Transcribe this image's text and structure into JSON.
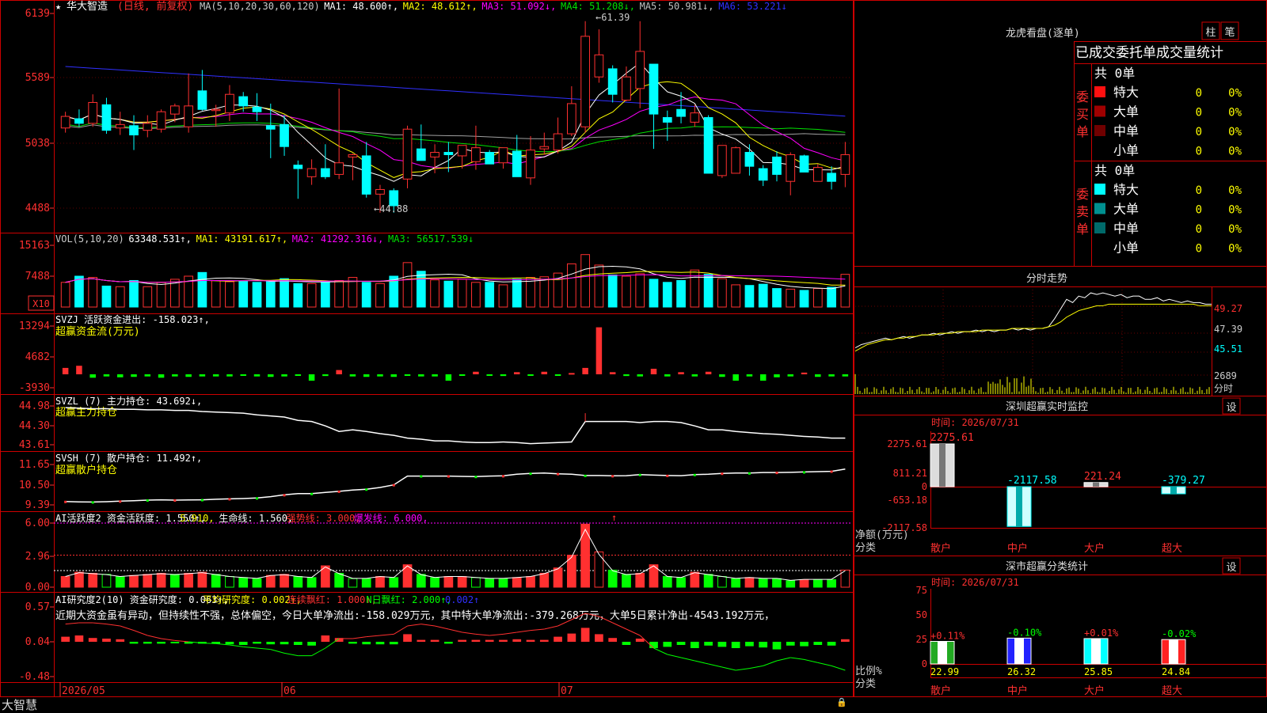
{
  "app": {
    "brand": "大智慧",
    "stock_name": "华大智造",
    "adj_note": "(日线, 前复权)",
    "lock_icon": "lock-icon"
  },
  "colors": {
    "up": "#ff3030",
    "down": "#00ffff",
    "ma1": "#ffffff",
    "ma2": "#ffff00",
    "ma3": "#ff00ff",
    "ma4": "#00e000",
    "ma5": "#a0a0a0",
    "ma6": "#3030ff",
    "grid": "#880000",
    "yellow": "#ffff00",
    "green": "#00ff00"
  },
  "price_panel": {
    "header": [
      {
        "t": "MA(5,10,20,30,60,120)",
        "c": "#ccc"
      },
      {
        "t": "MA1: 48.600↑,",
        "c": "#ffffff"
      },
      {
        "t": "MA2: 48.612↑,",
        "c": "#ffff00"
      },
      {
        "t": "MA3: 51.092↓,",
        "c": "#ff00ff"
      },
      {
        "t": "MA4: 51.208↓,",
        "c": "#00e000"
      },
      {
        "t": "MA5: 50.981↓,",
        "c": "#c0c0c0"
      },
      {
        "t": "MA6: 53.221↓",
        "c": "#3030ff"
      }
    ],
    "y_ticks": [
      "6139",
      "5589",
      "5038",
      "4488"
    ],
    "high_label": "61.39",
    "low_label": "44.88"
  },
  "vol_panel": {
    "header": [
      {
        "t": "VOL(5,10,20)",
        "c": "#ccc"
      },
      {
        "t": "63348.531↑,",
        "c": "#ffffff"
      },
      {
        "t": "MA1: 43191.617↑,",
        "c": "#ffff00"
      },
      {
        "t": "MA2: 41292.316↓,",
        "c": "#ff00ff"
      },
      {
        "t": "MA3: 56517.539↓",
        "c": "#00e000"
      }
    ],
    "y_ticks": [
      "15163",
      "7488"
    ],
    "unit": "X10"
  },
  "svzj_panel": {
    "header": [
      {
        "t": "SVZJ  活跃资金进出: -158.023↑,",
        "c": "#fff"
      }
    ],
    "sub": "超赢资金流(万元)",
    "y_ticks": [
      "13294",
      "4682",
      "-3930"
    ]
  },
  "svzl_panel": {
    "header": [
      {
        "t": "SVZL (7) 主力持仓: 43.692↓,",
        "c": "#fff"
      }
    ],
    "sub": "超赢主力持仓",
    "y_ticks": [
      "44.98",
      "44.30",
      "43.61"
    ]
  },
  "svsh_panel": {
    "header": [
      {
        "t": "SVSH (7) 散户持仓: 11.492↑,",
        "c": "#fff"
      }
    ],
    "sub": "超赢散户持仓",
    "y_ticks": [
      "11.65",
      "10.50",
      "9.39"
    ]
  },
  "ai_panel": {
    "header": [
      {
        "t": "AI活跃度2 资金活跃度: 1.550↑,",
        "c": "#fff"
      },
      {
        "t": "5.910,",
        "c": "#ffff00"
      },
      {
        "t": "生命线: 1.560,",
        "c": "#fff"
      },
      {
        "t": "强势线: 3.000,",
        "c": "#ff3030"
      },
      {
        "t": "爆发线: 6.000,",
        "c": "#ff00ff"
      }
    ],
    "y_ticks": [
      "6.00",
      "2.96",
      "0.00"
    ]
  },
  "ai2_panel": {
    "header": [
      {
        "t": "AI研究度2(10) 资金研究度: 0.063↑,",
        "c": "#fff"
      },
      {
        "t": "平均研究度: 0.002↑,",
        "c": "#ffff00"
      },
      {
        "t": "连续飘红: 1.000↑,",
        "c": "#ff3030"
      },
      {
        "t": "N日飘红: 2.000↑,",
        "c": "#00ff00"
      },
      {
        "t": "0.002↑",
        "c": "#3030ff"
      }
    ],
    "comment": "近期大资金虽有异动，但持续性不强，总体偏空，今日大单净流出:-158.029万元，其中特大单净流出:-379.268万元，大单5日累计净出-4543.192万元，",
    "y_ticks": [
      "0.57",
      "0.04",
      "-0.48"
    ]
  },
  "x_axis": [
    "2026/05",
    "06",
    "07"
  ],
  "candles": [
    [
      52.2,
      53.6,
      51.8,
      53.2
    ],
    [
      53.0,
      53.8,
      52.3,
      52.6
    ],
    [
      52.6,
      55.1,
      52.3,
      54.4
    ],
    [
      54.2,
      54.8,
      51.7,
      52.0
    ],
    [
      52.2,
      53.6,
      51.6,
      52.5
    ],
    [
      52.4,
      53.3,
      50.3,
      51.6
    ],
    [
      52.0,
      53.3,
      51.4,
      52.6
    ],
    [
      52.1,
      53.8,
      51.8,
      53.6
    ],
    [
      53.4,
      54.3,
      52.7,
      54.1
    ],
    [
      52.3,
      56.9,
      51.8,
      54.1
    ],
    [
      55.4,
      57.2,
      53.7,
      53.8
    ],
    [
      53.7,
      54.2,
      52.3,
      53.8
    ],
    [
      53.5,
      55.9,
      52.8,
      55.1
    ],
    [
      54.9,
      55.3,
      53.6,
      54.1
    ],
    [
      54.0,
      55.2,
      52.8,
      53.6
    ],
    [
      52.4,
      54.3,
      49.6,
      52.1
    ],
    [
      52.5,
      53.3,
      49.8,
      50.6
    ],
    [
      49.0,
      49.4,
      46.1,
      48.7
    ],
    [
      48.0,
      49.5,
      47.3,
      48.7
    ],
    [
      48.7,
      50.8,
      47.8,
      48.0
    ],
    [
      48.2,
      55.6,
      47.8,
      49.2
    ],
    [
      49.7,
      50.0,
      47.7,
      49.9
    ],
    [
      49.8,
      51.0,
      46.2,
      46.5
    ],
    [
      46.5,
      47.3,
      44.9,
      46.9
    ],
    [
      46.8,
      47.0,
      44.9,
      45.5
    ],
    [
      47.8,
      52.4,
      47.0,
      52.1
    ],
    [
      50.4,
      52.5,
      50.3,
      49.4
    ],
    [
      49.7,
      50.8,
      48.3,
      50.1
    ],
    [
      50.1,
      51.0,
      48.4,
      49.9
    ],
    [
      49.8,
      50.1,
      48.7,
      50.7
    ],
    [
      49.3,
      52.4,
      48.6,
      50.5
    ],
    [
      50.1,
      50.3,
      49.6,
      49.1
    ],
    [
      49.2,
      50.2,
      48.7,
      50.5
    ],
    [
      50.2,
      51.6,
      49.8,
      48.0
    ],
    [
      47.9,
      51.5,
      47.3,
      50.3
    ],
    [
      50.4,
      51.8,
      49.9,
      50.6
    ],
    [
      50.3,
      53.1,
      50.0,
      51.7
    ],
    [
      51.7,
      55.8,
      51.5,
      54.3
    ],
    [
      52.3,
      61.4,
      51.8,
      60.1
    ],
    [
      56.6,
      60.7,
      56.1,
      58.5
    ],
    [
      57.3,
      57.6,
      54.4,
      55.1
    ],
    [
      54.6,
      57.5,
      54.5,
      56.6
    ],
    [
      55.6,
      61.4,
      53.9,
      58.8
    ],
    [
      57.7,
      57.3,
      50.4,
      53.4
    ],
    [
      53.1,
      53.7,
      51.1,
      52.7
    ],
    [
      53.8,
      55.3,
      52.6,
      53.2
    ],
    [
      52.7,
      54.2,
      52.3,
      53.5
    ],
    [
      53.1,
      53.3,
      52.1,
      48.3
    ],
    [
      48.1,
      50.3,
      47.9,
      50.7
    ],
    [
      48.3,
      50.6,
      48.3,
      50.5
    ],
    [
      50.1,
      50.8,
      48.1,
      48.9
    ],
    [
      48.7,
      49.0,
      47.2,
      47.7
    ],
    [
      49.7,
      50.2,
      47.6,
      48.2
    ],
    [
      47.6,
      50.1,
      46.4,
      49.9
    ],
    [
      49.8,
      49.9,
      48.4,
      48.4
    ],
    [
      47.6,
      49.1,
      47.6,
      48.8
    ],
    [
      48.3,
      48.9,
      46.9,
      47.6
    ],
    [
      48.2,
      51.0,
      47.1,
      49.9
    ]
  ],
  "volumes": [
    0.4,
    0.5,
    0.48,
    0.34,
    0.33,
    0.43,
    0.33,
    0.4,
    0.45,
    0.5,
    0.56,
    0.43,
    0.41,
    0.42,
    0.4,
    0.42,
    0.46,
    0.38,
    0.38,
    0.4,
    0.43,
    0.48,
    0.4,
    0.38,
    0.5,
    0.72,
    0.58,
    0.44,
    0.42,
    0.45,
    0.4,
    0.4,
    0.36,
    0.45,
    0.48,
    0.49,
    0.55,
    0.7,
    0.85,
    0.68,
    0.52,
    0.5,
    0.54,
    0.45,
    0.4,
    0.43,
    0.6,
    0.53,
    0.46,
    0.36,
    0.35,
    0.37,
    0.3,
    0.29,
    0.27,
    0.3,
    0.32,
    0.53
  ],
  "fund_flow": [
    1.5,
    2.0,
    -0.8,
    -0.5,
    -0.7,
    -0.6,
    -0.5,
    -0.8,
    -0.5,
    -0.6,
    -0.5,
    -0.5,
    -0.5,
    -0.3,
    -0.5,
    -0.6,
    -0.5,
    -0.2,
    -1.5,
    -0.4,
    1.0,
    -0.5,
    -0.6,
    -0.5,
    -0.6,
    -0.3,
    -0.5,
    -0.5,
    -1.5,
    -0.3,
    0.6,
    -0.3,
    -0.4,
    0.5,
    -0.3,
    0.6,
    -0.3,
    0.3,
    1.5,
    11.0,
    0.5,
    -0.4,
    -0.5,
    1.3,
    -0.5,
    0.5,
    -0.5,
    0.6,
    -0.6,
    -1.5,
    -0.5,
    -1.5,
    -0.7,
    -0.5,
    0.4,
    -0.6,
    -0.5,
    -0.5
  ],
  "svzl_line": [
    44.95,
    44.94,
    44.93,
    44.93,
    44.92,
    44.92,
    44.91,
    44.91,
    44.9,
    44.9,
    44.88,
    44.87,
    44.86,
    44.85,
    44.82,
    44.8,
    44.78,
    44.72,
    44.7,
    44.62,
    44.52,
    44.55,
    44.52,
    44.48,
    44.45,
    44.4,
    44.38,
    44.35,
    44.35,
    44.33,
    44.32,
    44.32,
    44.33,
    44.32,
    44.3,
    44.31,
    44.32,
    44.33,
    44.7,
    44.7,
    44.7,
    44.7,
    44.68,
    44.7,
    44.7,
    44.68,
    44.62,
    44.55,
    44.55,
    44.52,
    44.5,
    44.48,
    44.47,
    44.45,
    44.43,
    44.42,
    44.4,
    44.4
  ],
  "svsh_line": [
    9.5,
    9.48,
    9.47,
    9.49,
    9.52,
    9.55,
    9.58,
    9.6,
    9.58,
    9.59,
    9.6,
    9.63,
    9.65,
    9.67,
    9.7,
    9.78,
    9.88,
    9.95,
    9.95,
    10.02,
    10.08,
    10.15,
    10.2,
    10.3,
    10.45,
    10.95,
    10.95,
    10.95,
    10.95,
    10.93,
    10.92,
    10.95,
    10.96,
    11.05,
    11.1,
    11.12,
    11.08,
    11.05,
    10.98,
    10.98,
    10.96,
    10.97,
    11.03,
    11.0,
    10.98,
    10.97,
    11.03,
    11.05,
    11.1,
    11.12,
    11.12,
    11.15,
    11.15,
    11.16,
    11.18,
    11.2,
    11.22,
    11.35
  ],
  "ai_bars": [
    1.0,
    1.4,
    1.3,
    1.2,
    1.0,
    1.1,
    1.2,
    1.3,
    1.2,
    1.3,
    1.4,
    1.2,
    1.0,
    0.9,
    0.8,
    1.1,
    1.2,
    1.0,
    0.9,
    2.0,
    1.3,
    0.8,
    0.8,
    1.0,
    0.9,
    2.1,
    1.2,
    0.9,
    1.0,
    1.0,
    0.9,
    0.8,
    0.8,
    0.9,
    1.0,
    1.3,
    1.8,
    3.0,
    5.9,
    3.3,
    1.6,
    1.2,
    1.3,
    2.1,
    1.0,
    0.9,
    1.4,
    1.2,
    1.0,
    0.8,
    0.9,
    0.8,
    0.8,
    0.6,
    0.7,
    0.7,
    0.7,
    1.6
  ],
  "ai_up": [
    1,
    1,
    1,
    0,
    0,
    1,
    1,
    1,
    0,
    1,
    1,
    0,
    0,
    0,
    0,
    1,
    1,
    0,
    0,
    1,
    0,
    0,
    0,
    1,
    0,
    1,
    0,
    0,
    1,
    1,
    0,
    0,
    0,
    1,
    1,
    1,
    1,
    1,
    1,
    1,
    0,
    0,
    1,
    1,
    0,
    0,
    1,
    0,
    0,
    0,
    1,
    0,
    0,
    0,
    1,
    0,
    0,
    1
  ],
  "ai2_bars": [
    0.08,
    0.1,
    0.06,
    0.05,
    0.04,
    -0.03,
    -0.03,
    -0.03,
    -0.02,
    -0.03,
    -0.03,
    -0.03,
    -0.04,
    -0.05,
    -0.03,
    -0.04,
    -0.04,
    -0.05,
    -0.06,
    0.1,
    0.06,
    -0.03,
    -0.04,
    -0.04,
    -0.04,
    0.12,
    0.03,
    0.03,
    -0.03,
    0.03,
    0.03,
    0.03,
    0.03,
    0.04,
    0.03,
    0.03,
    0.08,
    0.13,
    0.22,
    0.12,
    0.06,
    -0.05,
    0.05,
    -0.1,
    -0.08,
    -0.05,
    -0.1,
    -0.06,
    -0.08,
    -0.1,
    -0.07,
    -0.09,
    -0.12,
    -0.06,
    -0.07,
    -0.05,
    -0.06,
    0.04
  ],
  "ai2_line": [
    0.28,
    0.3,
    0.3,
    0.28,
    0.25,
    0.18,
    0.1,
    0.05,
    0.02,
    0.0,
    -0.02,
    -0.03,
    -0.05,
    -0.08,
    -0.1,
    -0.12,
    -0.18,
    -0.22,
    -0.22,
    -0.1,
    0.05,
    0.05,
    0.08,
    0.1,
    0.12,
    0.25,
    0.28,
    0.25,
    0.2,
    0.15,
    0.12,
    0.1,
    0.12,
    0.15,
    0.18,
    0.2,
    0.25,
    0.35,
    0.45,
    0.4,
    0.3,
    0.2,
    0.1,
    -0.1,
    -0.2,
    -0.25,
    -0.3,
    -0.35,
    -0.4,
    -0.45,
    -0.42,
    -0.38,
    -0.3,
    -0.25,
    -0.28,
    -0.33,
    -0.38,
    -0.45
  ],
  "side": {
    "lhb": {
      "title": "龙虎看盘(逐单)",
      "btn1": "柱",
      "btn2": "笔",
      "subtitle": "已成交委托单成交量统计",
      "buy": {
        "side_label": "委买单",
        "total": "共 0单",
        "rows": [
          {
            "color": "#ff1010",
            "name": "特大",
            "count": "0",
            "pct": "0%"
          },
          {
            "color": "#a00000",
            "name": "大单",
            "count": "0",
            "pct": "0%"
          },
          {
            "color": "#700000",
            "name": "中单",
            "count": "0",
            "pct": "0%"
          },
          {
            "color": "",
            "name": "小单",
            "count": "0",
            "pct": "0%"
          }
        ]
      },
      "sell": {
        "side_label": "委卖单",
        "total": "共 0单",
        "rows": [
          {
            "color": "#00ffff",
            "name": "特大",
            "count": "0",
            "pct": "0%"
          },
          {
            "color": "#009090",
            "name": "大单",
            "count": "0",
            "pct": "0%"
          },
          {
            "color": "#006a6a",
            "name": "中单",
            "count": "0",
            "pct": "0%"
          },
          {
            "color": "",
            "name": "小单",
            "count": "0",
            "pct": "0%"
          }
        ]
      }
    },
    "intraday": {
      "title": "分时走势",
      "y_ticks": [
        "49.27",
        "47.39",
        "45.51"
      ],
      "vol_tick": "2689",
      "vol_unit": "分时",
      "price_line": [
        46.2,
        46.4,
        46.5,
        46.6,
        46.7,
        46.8,
        46.7,
        46.8,
        46.9,
        46.8,
        46.9,
        47.0,
        47.0,
        47.1,
        47.0,
        47.1,
        47.2,
        47.1,
        47.2,
        47.2,
        47.3,
        47.2,
        47.3,
        47.2,
        47.3,
        47.3,
        47.4,
        47.3,
        47.4,
        47.3,
        47.4,
        47.4,
        47.5,
        48.0,
        48.6,
        49.2,
        49.0,
        49.4,
        49.3,
        49.6,
        49.5,
        49.6,
        49.5,
        49.4,
        49.5,
        49.3,
        49.4,
        49.4,
        49.2,
        49.2,
        49.3,
        49.1,
        49.2,
        49.1,
        49.0,
        49.1,
        49.0,
        49.0,
        48.9,
        48.9
      ],
      "avg_line": [
        46.0,
        46.2,
        46.4,
        46.5,
        46.6,
        46.7,
        46.7,
        46.8,
        46.8,
        46.9,
        46.9,
        47.0,
        47.0,
        47.0,
        47.1,
        47.1,
        47.1,
        47.2,
        47.2,
        47.2,
        47.2,
        47.3,
        47.3,
        47.3,
        47.3,
        47.3,
        47.4,
        47.4,
        47.4,
        47.4,
        47.4,
        47.4,
        47.5,
        47.6,
        47.8,
        48.1,
        48.3,
        48.5,
        48.6,
        48.7,
        48.8,
        48.8,
        48.9,
        48.9,
        48.9,
        48.9,
        48.9,
        48.9,
        48.9,
        48.9,
        48.9,
        48.9,
        48.9,
        48.9,
        48.9,
        48.9,
        48.9,
        48.8,
        48.8,
        48.8
      ]
    },
    "monitor": {
      "title": "深圳超赢实时监控",
      "btn": "设",
      "time": "时间: 2026/07/31",
      "y_ticks": [
        "2275.61",
        "811.21",
        "0",
        "-653.18",
        "-2117.58"
      ],
      "ylabel": "净额(万元)",
      "xlabel": "分类",
      "bars": [
        {
          "name": "散户",
          "value": 2275.61,
          "label": "2275.61"
        },
        {
          "name": "中户",
          "value": -2117.58,
          "label": "-2117.58"
        },
        {
          "name": "大户",
          "value": 221.24,
          "label": "221.24"
        },
        {
          "name": "超大",
          "value": -379.27,
          "label": "-379.27"
        }
      ]
    },
    "classify": {
      "title": "深市超赢分类统计",
      "btn": "设",
      "time": "时间: 2026/07/31",
      "y_ticks": [
        "75",
        "50",
        "25",
        "0"
      ],
      "ylabel": "比例%",
      "xlabel": "分类",
      "bars": [
        {
          "name": "散户",
          "value": 22.99,
          "top": "+0.11%",
          "top_c": "#ff3030",
          "c": "#2a2"
        },
        {
          "name": "中户",
          "value": 26.32,
          "top": "-0.10%",
          "top_c": "#00ff00",
          "c": "#22f"
        },
        {
          "name": "大户",
          "value": 25.85,
          "top": "+0.01%",
          "top_c": "#ff3030",
          "c": "#0ff"
        },
        {
          "name": "超大",
          "value": 24.84,
          "top": "-0.02%",
          "top_c": "#00ff00",
          "c": "#f22"
        }
      ]
    }
  }
}
